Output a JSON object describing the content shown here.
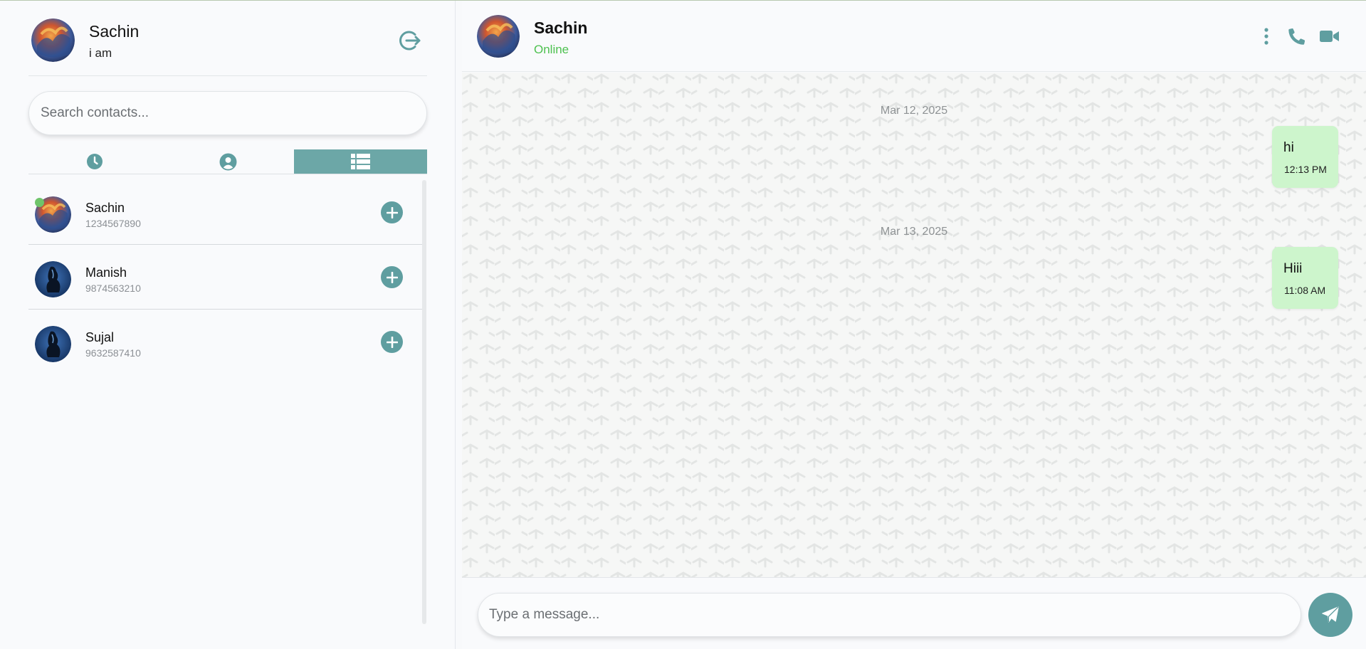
{
  "user": {
    "name": "Sachin",
    "status": "i am"
  },
  "search": {
    "placeholder": "Search contacts..."
  },
  "tabs": [
    {
      "icon": "clock-icon",
      "active": false
    },
    {
      "icon": "user-circle-icon",
      "active": false
    },
    {
      "icon": "list-icon",
      "active": true
    }
  ],
  "contacts": [
    {
      "name": "Sachin",
      "phone": "1234567890",
      "online": true
    },
    {
      "name": "Manish",
      "phone": "9874563210",
      "online": false
    },
    {
      "name": "Sujal",
      "phone": "9632587410",
      "online": false
    }
  ],
  "chat": {
    "name": "Sachin",
    "status": "Online",
    "messages": [
      {
        "date": "Mar 12, 2025",
        "text": "hi",
        "time": "12:13 PM",
        "outgoing": true
      },
      {
        "date": "Mar 13, 2025",
        "text": "Hiii",
        "time": "11:08 AM",
        "outgoing": true
      }
    ]
  },
  "composer": {
    "placeholder": "Type a message..."
  },
  "colors": {
    "accent": "#5f9ea0",
    "online": "#4ec150",
    "bubble": "#cdf5cc",
    "background": "#f9fafc"
  }
}
